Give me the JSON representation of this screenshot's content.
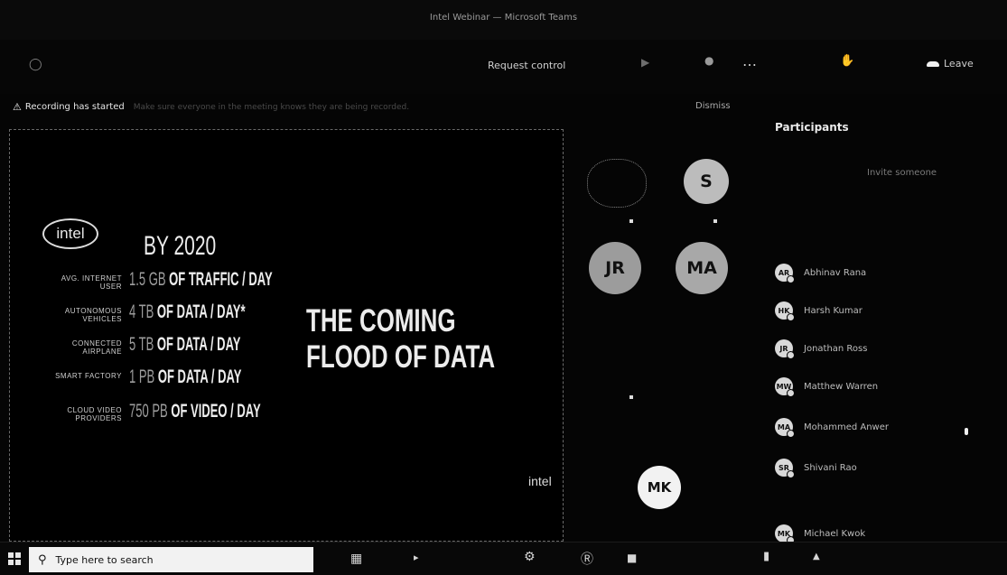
{
  "window": {
    "title": "Intel Webinar — Microsoft Teams"
  },
  "toolbar": {
    "request_control_label": "Request control",
    "more_label": "…",
    "leave_label": "Leave"
  },
  "banner": {
    "warning_text": "Recording has started",
    "message_text": "Make sure everyone in the meeting knows they are being recorded.",
    "dismiss_label": "Dismiss"
  },
  "slide": {
    "brand": "intel",
    "by_year": "BY 2020",
    "rows": [
      {
        "label": "AVG. INTERNET USER",
        "value": "1.5 GB",
        "unit": "OF TRAFFIC / DAY"
      },
      {
        "label": "AUTONOMOUS VEHICLES",
        "value": "4 TB",
        "unit": "OF DATA / DAY*"
      },
      {
        "label": "CONNECTED AIRPLANE",
        "value": "5 TB",
        "unit": "OF DATA / DAY"
      },
      {
        "label": "SMART FACTORY",
        "value": "1 PB",
        "unit": "OF DATA / DAY"
      },
      {
        "label": "CLOUD VIDEO PROVIDERS",
        "value": "750 PB",
        "unit": "OF VIDEO / DAY"
      }
    ],
    "headline_line1": "THE COMING",
    "headline_line2": "FLOOD OF DATA",
    "footer_brand": "intel"
  },
  "video_grid": {
    "tiles": [
      {
        "initials": "",
        "kind": "photo"
      },
      {
        "initials": "S"
      },
      {
        "initials": "JR"
      },
      {
        "initials": "MA"
      }
    ],
    "presenter": {
      "initials": "MK"
    }
  },
  "participants": {
    "title": "Participants",
    "invite_label": "Invite someone",
    "list": [
      {
        "initials": "AR",
        "name": "Abhinav Rana"
      },
      {
        "initials": "HK",
        "name": "Harsh Kumar"
      },
      {
        "initials": "JR",
        "name": "Jonathan Ross"
      },
      {
        "initials": "MW",
        "name": "Matthew Warren"
      },
      {
        "initials": "MA",
        "name": "Mohammed Anwer"
      },
      {
        "initials": "SR",
        "name": "Shivani Rao"
      },
      {
        "initials": "MK",
        "name": "Michael Kwok"
      }
    ]
  },
  "taskbar": {
    "search_placeholder": "Type here to search"
  },
  "colors": {
    "background": "#050505",
    "avatar": "#d9d9d9",
    "text": "#e8e8e8"
  }
}
